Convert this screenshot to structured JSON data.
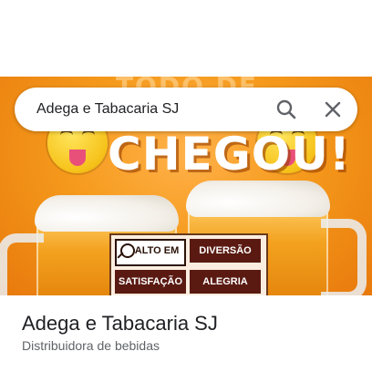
{
  "search": {
    "query": "Adega e Tabacaria SJ",
    "search_icon": "search-icon",
    "clear_icon": "close-icon"
  },
  "hero": {
    "banner_top": "TODO DE",
    "headline": "CHEGOU!",
    "tags": [
      "ALTO EM",
      "DIVERSÃO",
      "SATISFAÇÃO",
      "ALEGRIA"
    ]
  },
  "place": {
    "name": "Adega e Tabacaria SJ",
    "category": "Distribuidora de bebidas"
  },
  "colors": {
    "accent_orange": "#f59a1c",
    "tag_brown": "#5a1a12",
    "title_text": "#202124",
    "subtitle_text": "#5f6368"
  }
}
